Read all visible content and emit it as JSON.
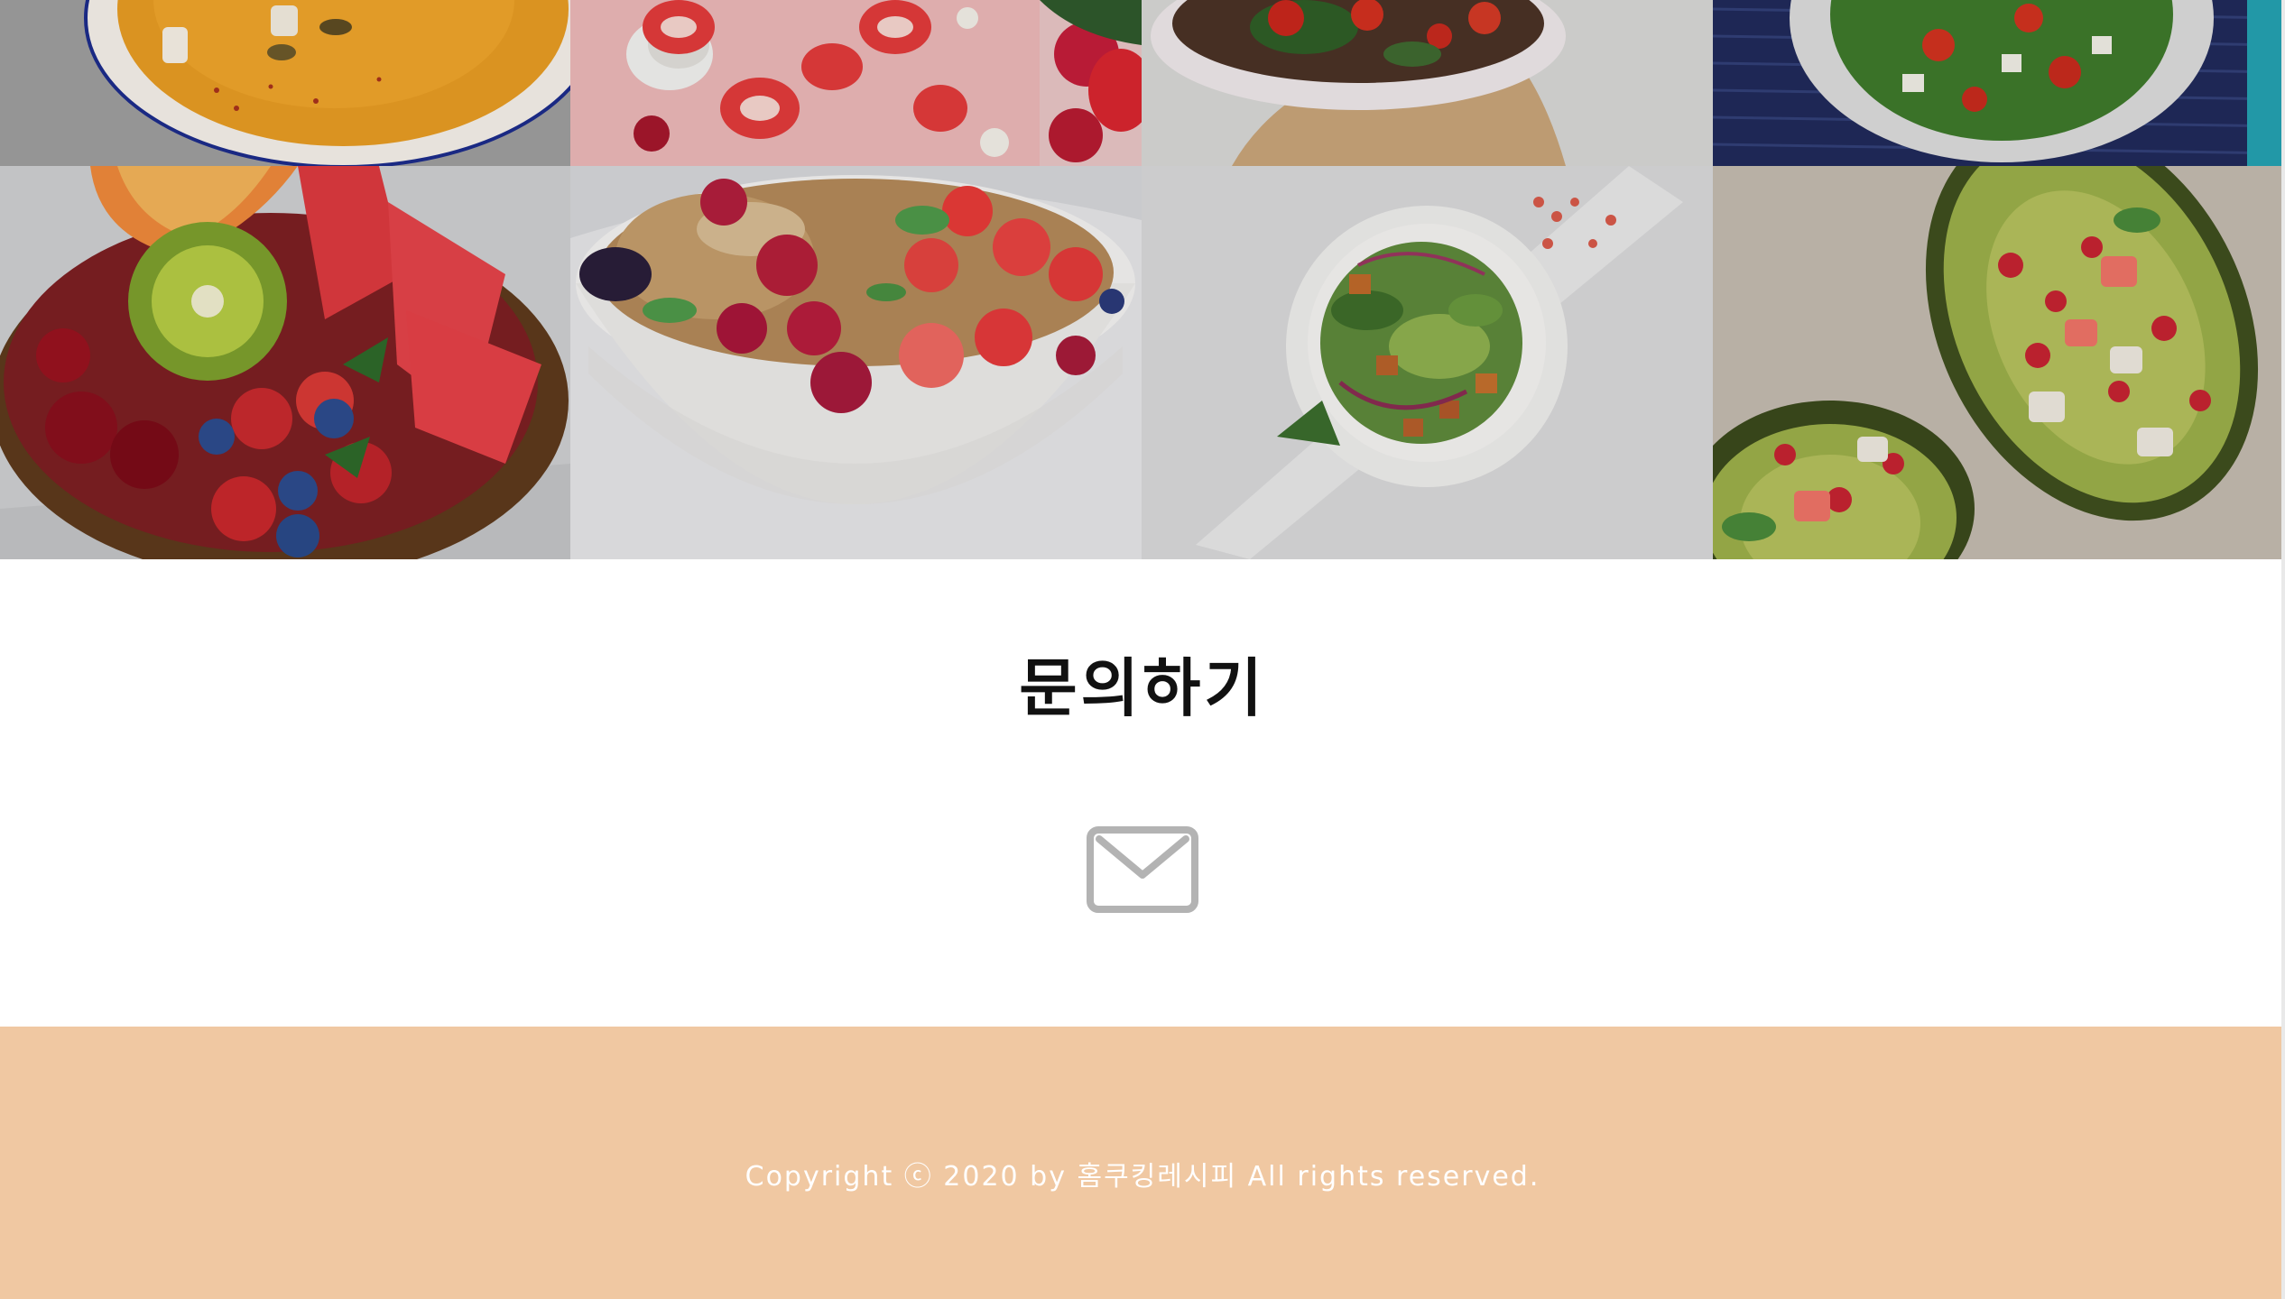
{
  "contact": {
    "title": "문의하기",
    "mail_icon": "envelope-icon",
    "mail_icon_color": "#b3b3b3"
  },
  "footer": {
    "copyright": "Copyright ⓒ 2020 by 홈쿠킹레시피 All rights reserved.",
    "background": "#f0c8a2"
  },
  "gallery": {
    "rows": [
      [
        "pumpkin-soup-image",
        "strawberry-smoothie-bowl-image",
        "toast-plate-image",
        "spinach-tomato-salad-image"
      ],
      [
        "fruit-coconut-bowl-image",
        "berry-granola-bowl-image",
        "green-salad-plate-image",
        "stuffed-avocado-image"
      ]
    ]
  }
}
